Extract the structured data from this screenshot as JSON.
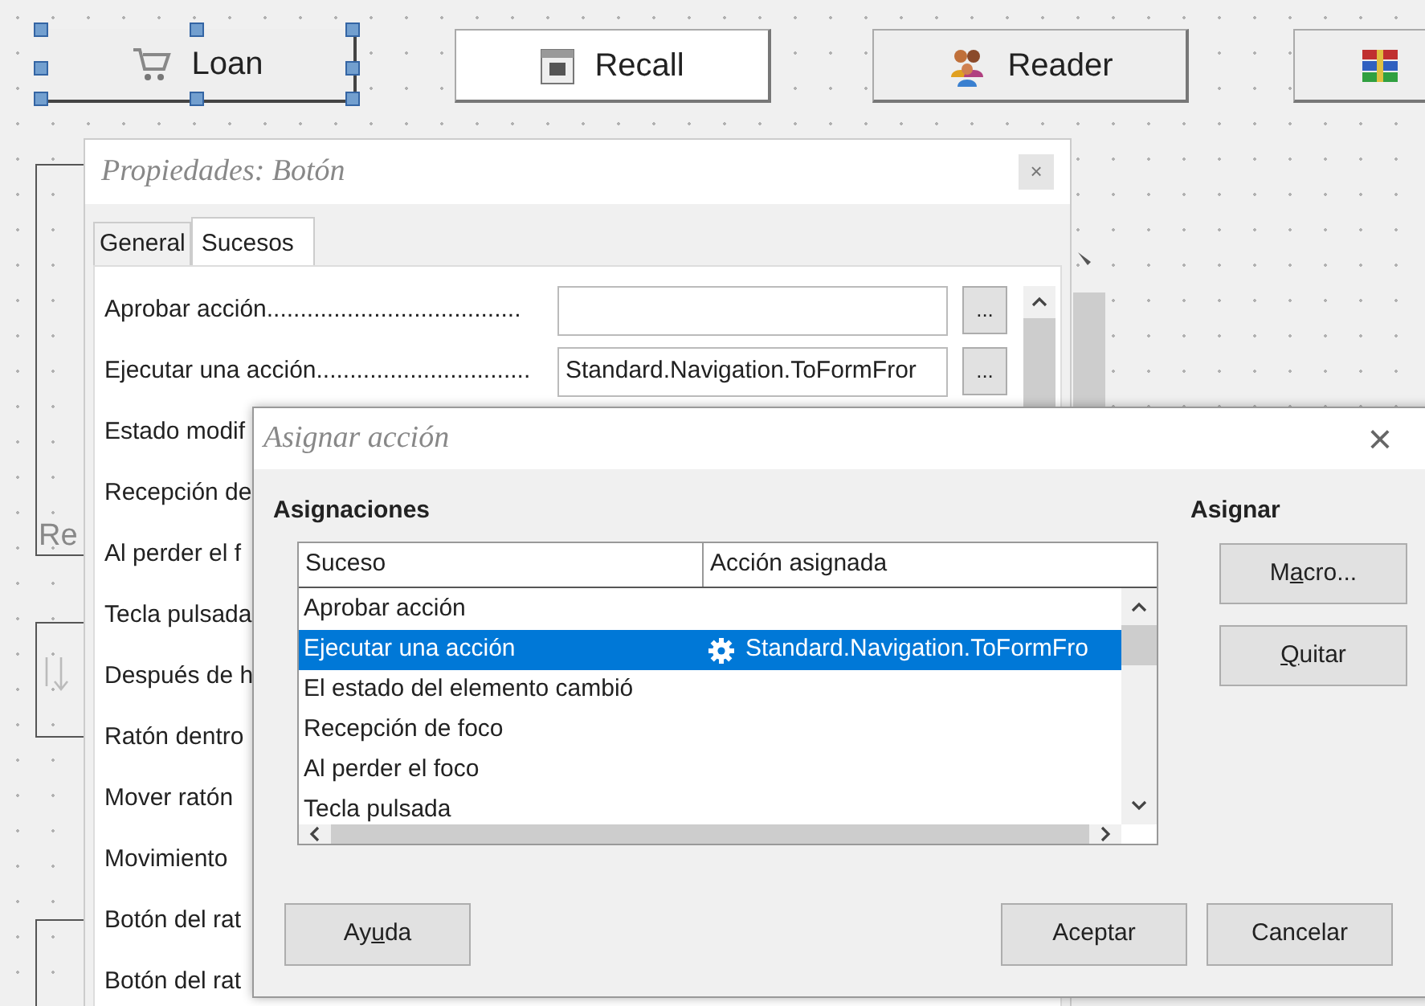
{
  "form_buttons": [
    {
      "label": "Loan",
      "selected": true,
      "highlighted": false
    },
    {
      "label": "Recall",
      "selected": false,
      "highlighted": true
    },
    {
      "label": "Reader",
      "selected": false,
      "highlighted": false
    },
    {
      "selected": false,
      "highlighted": false
    }
  ],
  "background_frame": {
    "label": "Re"
  },
  "properties_dialog": {
    "title": "Propiedades: Botón",
    "close": "×",
    "tabs": [
      {
        "label": "General",
        "selected": false
      },
      {
        "label": "Sucesos",
        "selected": true
      }
    ],
    "events": [
      {
        "kind": "field",
        "label": "Aprobar acción......................................",
        "button": "..."
      },
      {
        "kind": "field",
        "label": "Ejecutar una acción................................",
        "value": "Standard.Navigation.ToFormFror",
        "button": "..."
      },
      {
        "kind": "label",
        "label": "Estado modif"
      },
      {
        "kind": "label",
        "label": "Recepción de"
      },
      {
        "kind": "label",
        "label": "Al perder el f"
      },
      {
        "kind": "label",
        "label": "Tecla pulsada"
      },
      {
        "kind": "label",
        "label": "Después de h"
      },
      {
        "kind": "label",
        "label": "Ratón dentro"
      },
      {
        "kind": "label",
        "label": "Mover ratón"
      },
      {
        "kind": "label",
        "label": "Movimiento"
      },
      {
        "kind": "label",
        "label": "Botón del rat"
      },
      {
        "kind": "label",
        "label": "Botón del rat"
      }
    ]
  },
  "assign_dialog": {
    "title": "Asignar acción",
    "close": "×",
    "section": "Asignaciones",
    "assign_heading": "Asignar",
    "columns": [
      "Suceso",
      "Acción asignada"
    ],
    "rows": [
      {
        "event": "Aprobar acción",
        "selected": false
      },
      {
        "event": "Ejecutar una acción",
        "action": "Standard.Navigation.ToFormFro",
        "selected": true
      },
      {
        "event": "El estado del elemento cambió",
        "selected": false
      },
      {
        "event": "Recepción de foco",
        "selected": false
      },
      {
        "event": "Al perder el foco",
        "selected": false
      },
      {
        "event": "Tecla pulsada",
        "selected": false
      }
    ],
    "side_buttons": [
      {
        "before": "M",
        "key": "a",
        "after": "cro..."
      },
      {
        "key": "Q",
        "after": "uitar"
      }
    ],
    "footer_buttons": [
      {
        "before": "Ay",
        "key": "u",
        "after": "da"
      },
      {
        "before": "Aceptar"
      },
      {
        "before": "Cancelar"
      }
    ]
  }
}
